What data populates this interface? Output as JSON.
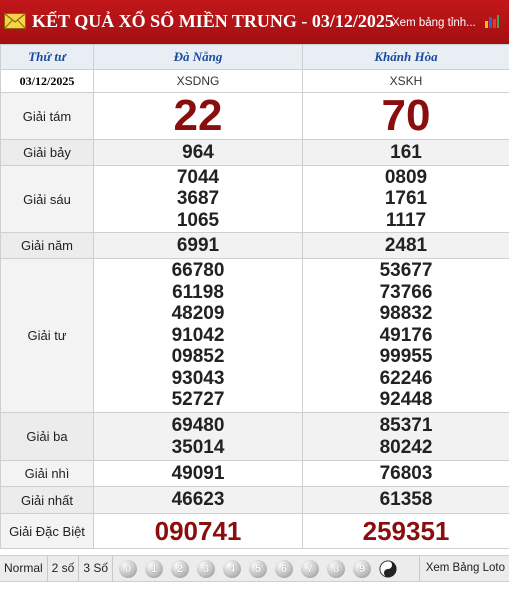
{
  "header": {
    "title": "KẾT QUẢ XỔ SỐ MIỀN TRUNG - 03/12/2025",
    "view_link": "Xem bảng tỉnh..."
  },
  "table": {
    "columns": [
      "Thứ tư",
      "Đà Nẵng",
      "Khánh Hòa"
    ],
    "date": "03/12/2025",
    "codes": [
      "XSDNG",
      "XSKH"
    ],
    "rows": [
      {
        "label": "Giải tám",
        "a": [
          "22"
        ],
        "b": [
          "70"
        ]
      },
      {
        "label": "Giải bảy",
        "a": [
          "964"
        ],
        "b": [
          "161"
        ]
      },
      {
        "label": "Giải sáu",
        "a": [
          "7044",
          "3687",
          "1065"
        ],
        "b": [
          "0809",
          "1761",
          "1117"
        ]
      },
      {
        "label": "Giải năm",
        "a": [
          "6991"
        ],
        "b": [
          "2481"
        ]
      },
      {
        "label": "Giải tư",
        "a": [
          "66780",
          "61198",
          "48209",
          "91042",
          "09852",
          "93043",
          "52727"
        ],
        "b": [
          "53677",
          "73766",
          "98832",
          "49176",
          "99955",
          "62246",
          "92448"
        ]
      },
      {
        "label": "Giải ba",
        "a": [
          "69480",
          "35014"
        ],
        "b": [
          "85371",
          "80242"
        ]
      },
      {
        "label": "Giải nhì",
        "a": [
          "49091"
        ],
        "b": [
          "76803"
        ]
      },
      {
        "label": "Giải nhất",
        "a": [
          "46623"
        ],
        "b": [
          "61358"
        ]
      },
      {
        "label": "Giải Đặc Biệt",
        "a": [
          "090741"
        ],
        "b": [
          "259351"
        ]
      }
    ]
  },
  "footer": {
    "modes": [
      "Normal",
      "2 số",
      "3 Số"
    ],
    "digits": [
      "0",
      "1",
      "2",
      "3",
      "4",
      "5",
      "6",
      "7",
      "8",
      "9"
    ],
    "loto_link": "Xem Bảng Loto"
  },
  "colors": {
    "header_red": "#b3121a",
    "prize_red": "#8b0e0e",
    "column_blue": "#1a4a9c"
  }
}
